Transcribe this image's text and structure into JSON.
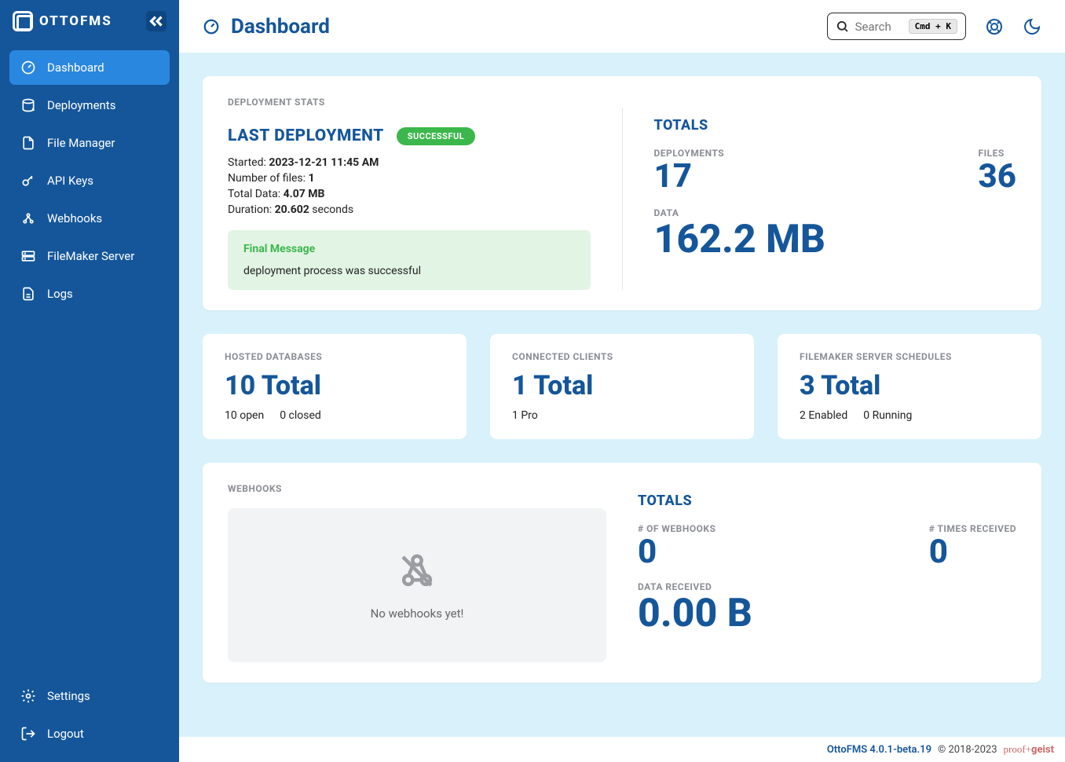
{
  "app_name": "OTTOFMS",
  "header": {
    "title": "Dashboard",
    "search_placeholder": "Search",
    "search_kbd": "Cmd + K"
  },
  "sidebar": {
    "items": [
      {
        "label": "Dashboard",
        "icon": "gauge-icon",
        "active": true
      },
      {
        "label": "Deployments",
        "icon": "database-icon",
        "active": false
      },
      {
        "label": "File Manager",
        "icon": "file-icon",
        "active": false
      },
      {
        "label": "API Keys",
        "icon": "key-icon",
        "active": false
      },
      {
        "label": "Webhooks",
        "icon": "webhook-icon",
        "active": false
      },
      {
        "label": "FileMaker Server",
        "icon": "server-icon",
        "active": false
      },
      {
        "label": "Logs",
        "icon": "logs-icon",
        "active": false
      }
    ],
    "settings_label": "Settings",
    "logout_label": "Logout"
  },
  "deployment_stats": {
    "section_label": "DEPLOYMENT STATS",
    "last_deployment": {
      "title": "LAST DEPLOYMENT",
      "status": "SUCCESSFUL",
      "started_label": "Started:",
      "started_value": "2023-12-21 11:45 AM",
      "files_label": "Number of files:",
      "files_value": "1",
      "data_label": "Total Data:",
      "data_value": "4.07 MB",
      "duration_label": "Duration:",
      "duration_value": "20.602",
      "duration_unit": "seconds",
      "final_title": "Final Message",
      "final_body": "deployment process was successful"
    },
    "totals": {
      "title": "TOTALS",
      "deployments_label": "DEPLOYMENTS",
      "deployments_value": "17",
      "files_label": "FILES",
      "files_value": "36",
      "data_label": "DATA",
      "data_value": "162.2 MB"
    }
  },
  "mini": {
    "hosted": {
      "label": "HOSTED DATABASES",
      "value": "10 Total",
      "open": "10 open",
      "closed": "0 closed"
    },
    "clients": {
      "label": "CONNECTED CLIENTS",
      "value": "1 Total",
      "sub": "1 Pro"
    },
    "schedules": {
      "label": "FILEMAKER SERVER SCHEDULES",
      "value": "3 Total",
      "enabled": "2 Enabled",
      "running": "0 Running"
    }
  },
  "webhooks": {
    "section_label": "WEBHOOKS",
    "empty_text": "No webhooks yet!",
    "totals": {
      "title": "TOTALS",
      "count_label": "# OF WEBHOOKS",
      "count_value": "0",
      "times_label": "# TIMES RECEIVED",
      "times_value": "0",
      "data_label": "DATA RECEIVED",
      "data_value": "0.00 B"
    }
  },
  "footer": {
    "version": "OttoFMS 4.0.1-beta.19",
    "copyright": "© 2018-2023",
    "brand": "proof+geist"
  }
}
